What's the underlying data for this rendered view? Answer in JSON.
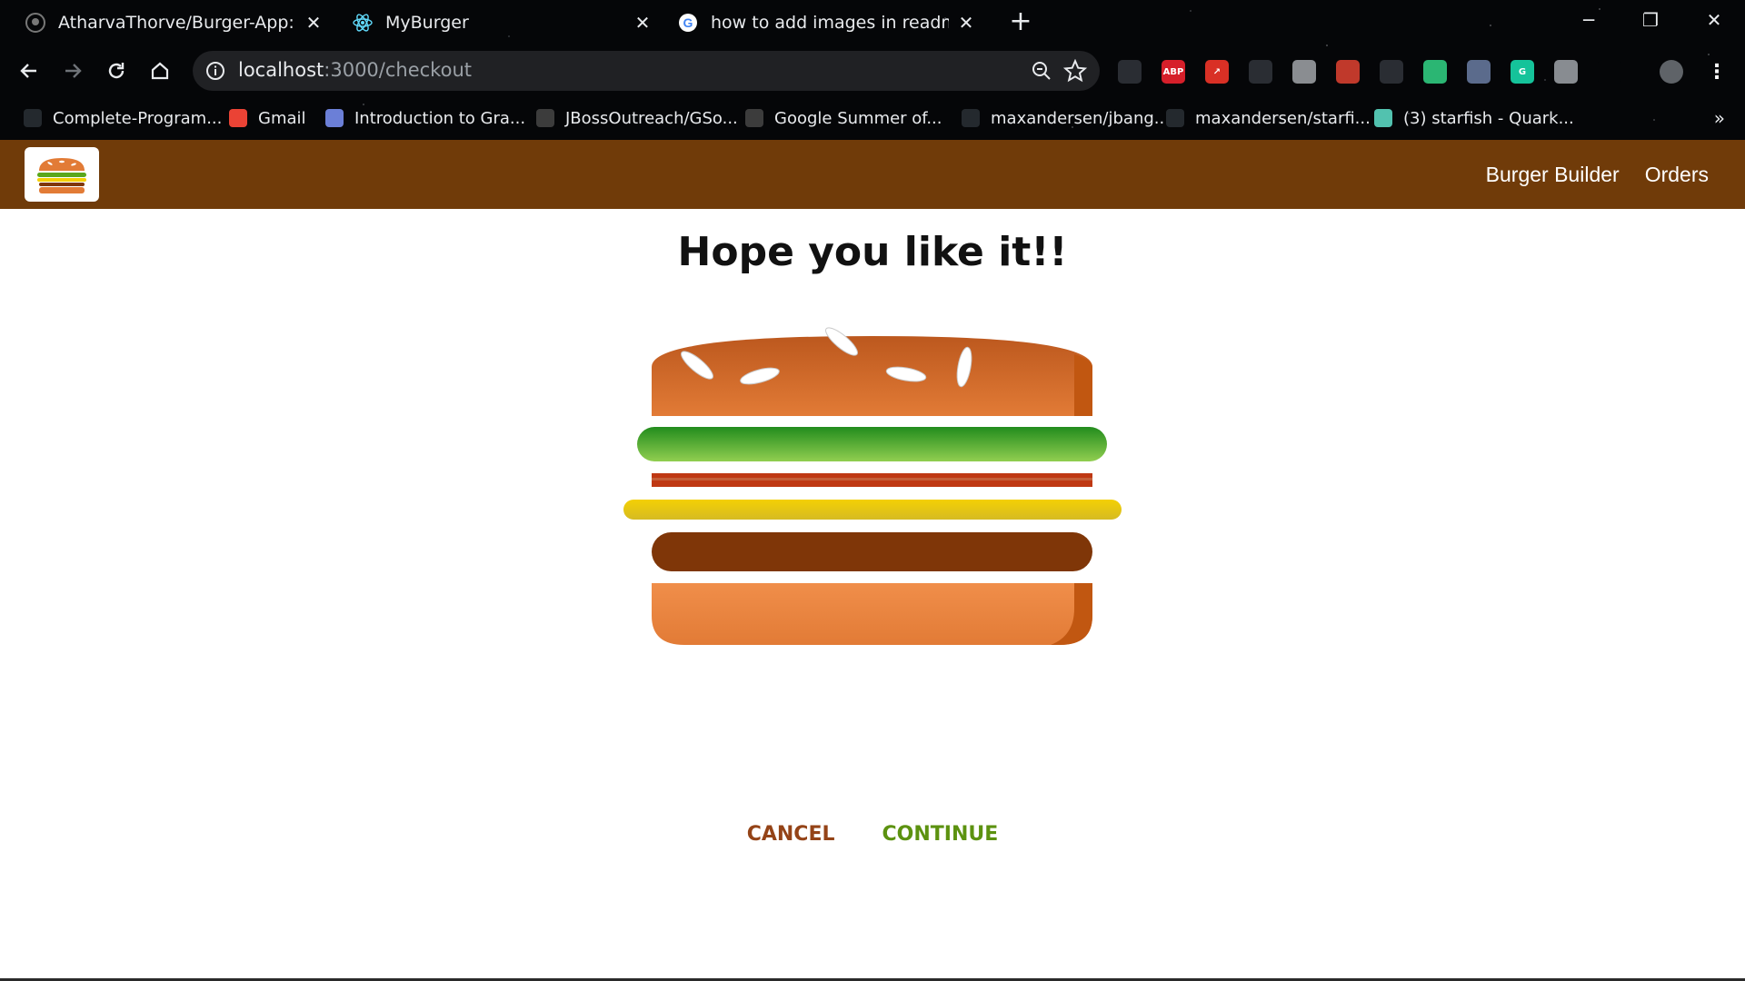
{
  "browser": {
    "tabs": [
      {
        "title": "AtharvaThorve/Burger-App: A Re",
        "icon": "github-icon"
      },
      {
        "title": "MyBurger",
        "icon": "react-icon"
      },
      {
        "title": "how to add images in readme file",
        "icon": "google-icon"
      }
    ],
    "new_tab": "+",
    "url": {
      "host": "localhost",
      "path": ":3000/checkout"
    },
    "extensions": [
      {
        "icon": "pencil-icon",
        "label": "",
        "color": "#2a2d33"
      },
      {
        "icon": "adblock-plus-icon",
        "label": "ABP",
        "color": "#d61f2a"
      },
      {
        "icon": "arrow-ext-icon",
        "label": "↗",
        "color": "#d93025"
      },
      {
        "icon": "glasses-ext-icon",
        "label": "",
        "color": "#2a2d33"
      },
      {
        "icon": "mercury-ext-icon",
        "label": "",
        "color": "#8a8d91"
      },
      {
        "icon": "dots-ext-icon",
        "label": "",
        "color": "#c0392b"
      },
      {
        "icon": "satellite-ext-icon",
        "label": "",
        "color": "#2a2d33"
      },
      {
        "icon": "target-ext-icon",
        "label": "",
        "color": "#2bb673"
      },
      {
        "icon": "o-ext-icon",
        "label": "",
        "color": "#5b6b8c"
      },
      {
        "icon": "grammarly-icon",
        "label": "G",
        "color": "#15c39a"
      },
      {
        "icon": "reader-ext-icon",
        "label": "",
        "color": "#888c91"
      },
      {
        "icon": "playlist-icon",
        "label": "",
        "color": "#050608"
      }
    ],
    "bookmarks": [
      {
        "label": "Complete-Program...",
        "icon": "github-icon",
        "color": "#24292e"
      },
      {
        "label": "Gmail",
        "icon": "gmail-icon",
        "color": "#ea4335"
      },
      {
        "label": "Introduction to Gra...",
        "icon": "course-icon",
        "color": "#6b7fd7"
      },
      {
        "label": "JBossOutreach/GSo...",
        "icon": "jboss-icon",
        "color": "#3c3c3c"
      },
      {
        "label": "Google Summer of...",
        "icon": "gsoc-icon",
        "color": "#3c3c3c"
      },
      {
        "label": "maxandersen/jbang...",
        "icon": "github-icon",
        "color": "#24292e"
      },
      {
        "label": "maxandersen/starfi...",
        "icon": "github-icon",
        "color": "#24292e"
      },
      {
        "label": "(3) starfish - Quark...",
        "icon": "zulip-icon",
        "color": "#52c2af"
      }
    ],
    "bookmarks_more": "»"
  },
  "app": {
    "nav": {
      "builder": "Burger Builder",
      "orders": "Orders"
    },
    "headline": "Hope you like it!!",
    "actions": {
      "cancel": "CANCEL",
      "continue": "CONTINUE"
    },
    "colors": {
      "toolbar": "#703b09",
      "bread_top": "#e27b36",
      "salad": "#228c1d",
      "bacon": "#bf3813",
      "cheese": "#f4d004",
      "meat": "#7f3608",
      "cancel": "#944317",
      "continue": "#5c9210"
    }
  }
}
